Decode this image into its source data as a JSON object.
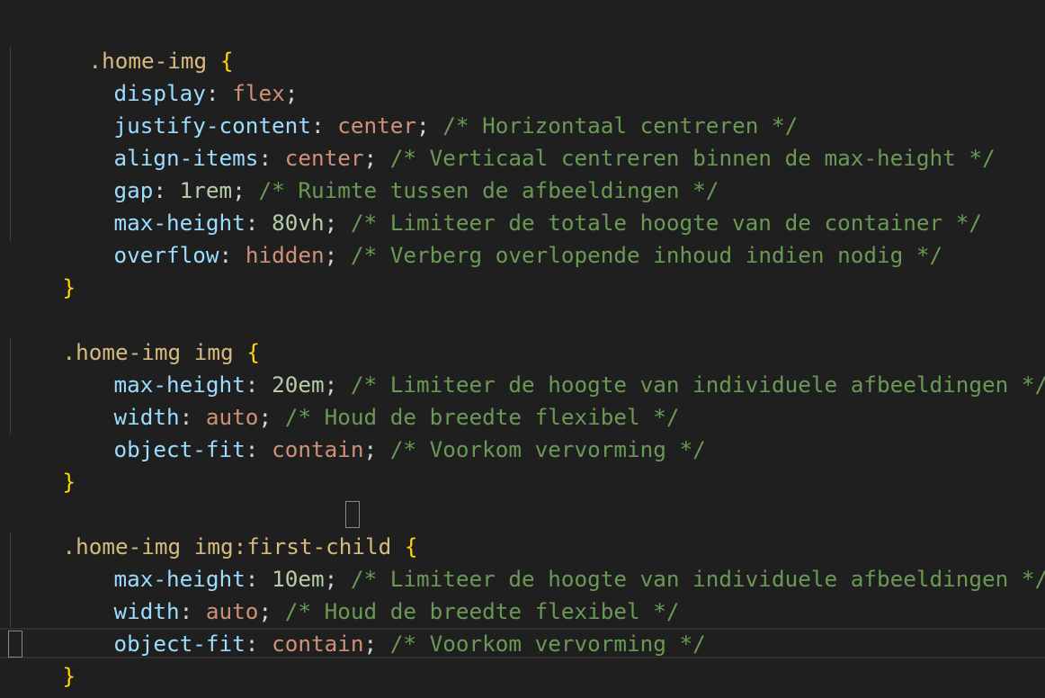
{
  "colors": {
    "background": "#1f1f1f",
    "selector": "#d7ba7d",
    "brace": "#ffd700",
    "property": "#9cdcfe",
    "value": "#ce9178",
    "number": "#b5cea8",
    "comment": "#6a9955"
  },
  "code": {
    "block1": {
      "selector": ".home-img",
      "open": "{",
      "close": "}",
      "decls": [
        {
          "prop": "display",
          "val": "flex",
          "comment": ""
        },
        {
          "prop": "justify-content",
          "val": "center",
          "comment": "/* Horizontaal centreren */"
        },
        {
          "prop": "align-items",
          "val": "center",
          "comment": "/* Verticaal centreren binnen de max-height */"
        },
        {
          "prop": "gap",
          "val": "1rem",
          "comment": "/* Ruimte tussen de afbeeldingen */"
        },
        {
          "prop": "max-height",
          "val": "80vh",
          "comment": "/* Limiteer de totale hoogte van de container */"
        },
        {
          "prop": "overflow",
          "val": "hidden",
          "comment": "/* Verberg overlopende inhoud indien nodig */"
        }
      ]
    },
    "block2": {
      "selector": ".home-img img",
      "open": "{",
      "close": "}",
      "decls": [
        {
          "prop": "max-height",
          "val": "20em",
          "comment": "/* Limiteer de hoogte van individuele afbeeldingen */"
        },
        {
          "prop": "width",
          "val": "auto",
          "comment": "/* Houd de breedte flexibel */"
        },
        {
          "prop": "object-fit",
          "val": "contain",
          "comment": "/* Voorkom vervorming */"
        }
      ]
    },
    "block3": {
      "selector": ".home-img img:first-child",
      "open": "{",
      "close": "}",
      "decls": [
        {
          "prop": "max-height",
          "val": "10em",
          "comment": "/* Limiteer de hoogte van individuele afbeeldingen */"
        },
        {
          "prop": "width",
          "val": "auto",
          "comment": "/* Houd de breedte flexibel */"
        },
        {
          "prop": "object-fit",
          "val": "contain",
          "comment": "/* Voorkom vervorming */"
        }
      ]
    }
  }
}
